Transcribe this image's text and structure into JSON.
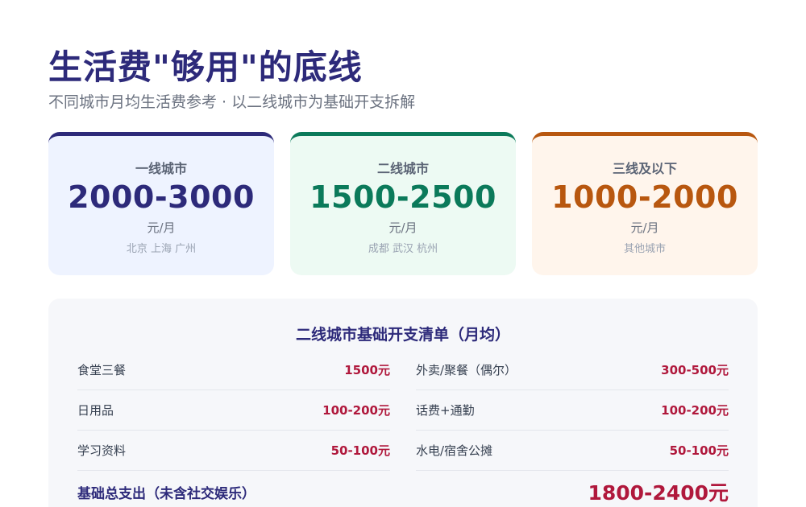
{
  "header": {
    "title": "生活费\"够用\"的底线",
    "subtitle": "不同城市月均生活费参考 · 以二线城市为基础开支拆解"
  },
  "cards": [
    {
      "label": "一线城市",
      "range": "2000-3000",
      "unit": "元/月",
      "cities": "北京 上海 广州",
      "accent": "#2d2a7a",
      "bg": "#eef3ff"
    },
    {
      "label": "二线城市",
      "range": "1500-2500",
      "unit": "元/月",
      "cities": "成都 武汉 杭州",
      "accent": "#0b7a5a",
      "bg": "#edfaf3"
    },
    {
      "label": "三线及以下",
      "range": "1000-2000",
      "unit": "元/月",
      "cities": "其他城市",
      "accent": "#b8570f",
      "bg": "#fff5ec"
    }
  ],
  "breakdown": {
    "title": "二线城市基础开支清单（月均）",
    "left": [
      {
        "name": "食堂三餐",
        "value": "1500元"
      },
      {
        "name": "日用品",
        "value": "100-200元"
      },
      {
        "name": "学习资料",
        "value": "50-100元"
      }
    ],
    "right": [
      {
        "name": "外卖/聚餐（偶尔）",
        "value": "300-500元"
      },
      {
        "name": "话费+通勤",
        "value": "100-200元"
      },
      {
        "name": "水电/宿舍公摊",
        "value": "50-100元"
      }
    ],
    "total_label": "基础总支出（未含社交娱乐）",
    "total_value": "1800-2400元"
  }
}
